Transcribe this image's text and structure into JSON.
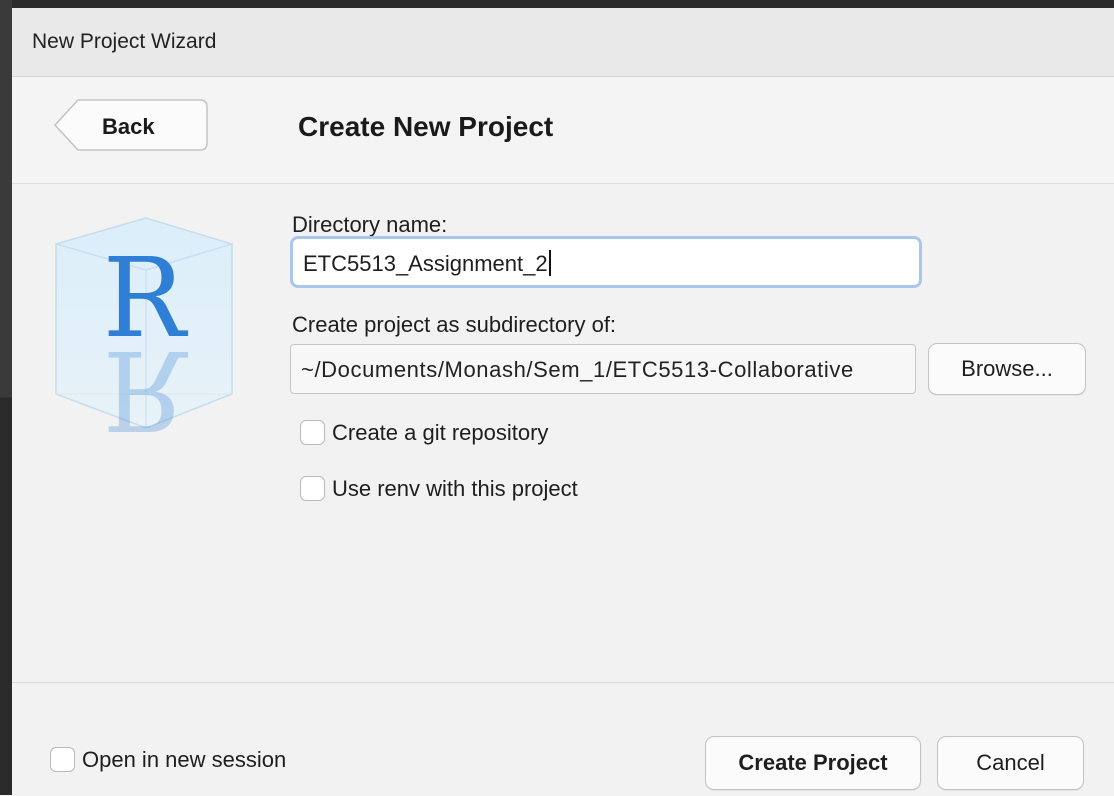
{
  "window": {
    "title": "New Project Wizard"
  },
  "header": {
    "back_label": "Back",
    "heading": "Create New Project"
  },
  "form": {
    "directory_name_label": "Directory name:",
    "directory_name_value": "ETC5513_Assignment_2",
    "subdirectory_label": "Create project as subdirectory of:",
    "subdirectory_value": "~/Documents/Monash/Sem_1/ETC5513-Collaborative",
    "browse_label": "Browse...",
    "git_checkbox": {
      "label": "Create a git repository",
      "checked": false
    },
    "renv_checkbox": {
      "label": "Use renv with this project",
      "checked": false
    }
  },
  "footer": {
    "new_session_checkbox": {
      "label": "Open in new session",
      "checked": false
    },
    "create_label": "Create Project",
    "cancel_label": "Cancel"
  },
  "logo": {
    "icon": "r-cube-logo-icon",
    "letter": "R"
  },
  "colors": {
    "focus_ring": "#a9c6ec",
    "r_blue": "#2f7fd6"
  }
}
